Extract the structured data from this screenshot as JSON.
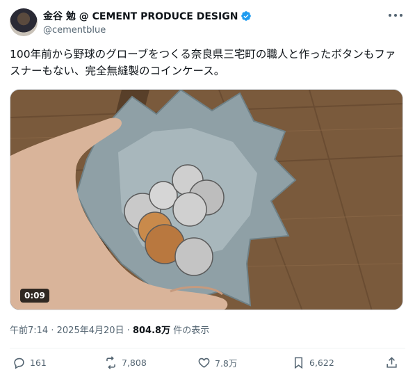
{
  "header": {
    "display_name": "金谷 勉 @ CEMENT PRODUCE DESIGN",
    "handle": "@cementblue"
  },
  "tweet": {
    "text": "100年前から野球のグローブをつくる奈良県三宅町の職人と作ったボタンもファスナーもない、完全無縫製のコインケース。"
  },
  "media": {
    "duration": "0:09"
  },
  "meta": {
    "time": "午前7:14",
    "separator": "·",
    "date": "2025年4月20日",
    "views_count": "804.8万",
    "views_label": "件の表示"
  },
  "actions": {
    "replies": "161",
    "reposts": "7,808",
    "likes": "7.8万",
    "bookmarks": "6,622"
  },
  "colors": {
    "verified_badge": "#1d9bf0",
    "secondary_text": "#536471",
    "primary_text": "#0f1419"
  },
  "icons": [
    "avatar",
    "verified-badge-icon",
    "more-icon",
    "play-video",
    "reply-icon",
    "repost-icon",
    "like-icon",
    "bookmark-icon",
    "share-icon"
  ]
}
